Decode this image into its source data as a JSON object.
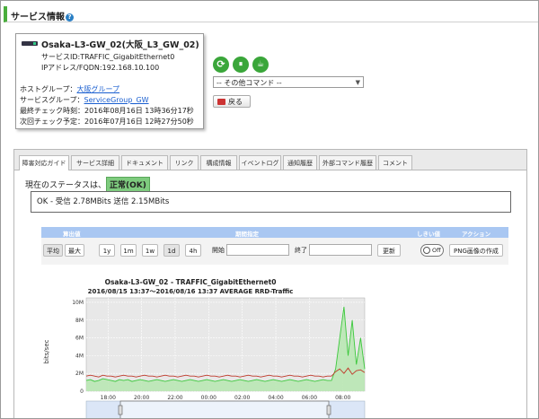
{
  "header": {
    "title": "サービス情報"
  },
  "info": {
    "name": "Osaka-L3-GW_02(大阪_L3_GW_02)",
    "service_id": "サービスID:TRAFFIC_GigabitEthernet0",
    "ip": "IPアドレス/FQDN:192.168.10.100",
    "host_group_label": "ホストグループ：",
    "host_group": "大阪グループ",
    "service_group_label": "サービスグループ：",
    "service_group": "ServiceGroup_GW",
    "last_check": "最終チェック時刻：2016年08月16日 13時36分17秒",
    "next_check": "次回チェック予定：2016年07月16日 12時27分50秒"
  },
  "actions": {
    "select_value": "-- その他コマンド --",
    "back_label": "戻る",
    "icons": [
      "refresh-icon",
      "pause-icon",
      "coffee-icon"
    ]
  },
  "tabs": [
    "障害対応ガイド",
    "サービス詳細",
    "ドキュメント",
    "リンク",
    "構成情報",
    "イベントログ",
    "通知履歴",
    "外部コマンド履歴",
    "コメント"
  ],
  "status": {
    "label": "現在のステータスは、",
    "badge": "正常(OK)",
    "badge_color": "#7ecb7e",
    "message": "OK - 受信 2.78MBits 送信 2.15MBits"
  },
  "controls": {
    "headers": {
      "calc": "算出値",
      "period": "期間指定",
      "threshold": "しきい値",
      "action": "アクション"
    },
    "avg": "平均",
    "max": "最大",
    "ranges": [
      "1y",
      "1m",
      "1w",
      "1d",
      "4h"
    ],
    "start_label": "開始",
    "end_label": "終了",
    "update": "更新",
    "toggle": "Off",
    "png": "PNG画像の作成"
  },
  "chart_data": {
    "type": "area",
    "title": "Osaka-L3-GW_02 - TRAFFIC_GigabitEthernet0",
    "subtitle": "2016/08/15 13:37～2016/08/16 13:37 AVERAGE RRD-Traffic",
    "ylabel": "bits/sec",
    "yticks": [
      "0",
      "2M",
      "4M",
      "6M",
      "8M",
      "10M"
    ],
    "ylim": [
      0,
      10.5
    ],
    "xticks": [
      "18:00",
      "20:00",
      "22:00",
      "00:00",
      "02:00",
      "04:00",
      "06:00",
      "08:00"
    ],
    "series": [
      {
        "color": "#3cc83c",
        "values": [
          1.2,
          1.3,
          1.1,
          1.2,
          1.4,
          1.3,
          1.2,
          1.1,
          1.3,
          1.2,
          1.3,
          1.1,
          1.2,
          1.3,
          1.2,
          1.1,
          1.2,
          1.3,
          1.2,
          1.1,
          1.2,
          1.3,
          1.2,
          1.1,
          1.2,
          1.3,
          1.2,
          1.1,
          1.2,
          1.3,
          1.2,
          1.1,
          1.2,
          1.3,
          1.2,
          1.1,
          1.2,
          1.3,
          1.2,
          1.1,
          1.2,
          1.3,
          1.2,
          1.1,
          1.2,
          1.3,
          1.2,
          1.1,
          1.2,
          1.3,
          1.2,
          1.1,
          1.2,
          1.3,
          1.2,
          1.1,
          1.2,
          1.3,
          1.2,
          1.2,
          2.5,
          6,
          9.5,
          4,
          8,
          3,
          6,
          2.5
        ]
      },
      {
        "color": "#c0392b",
        "values": [
          1.7,
          1.8,
          1.7,
          1.6,
          1.8,
          1.7,
          1.7,
          1.6,
          1.7,
          1.8,
          1.7,
          1.7,
          1.6,
          1.7,
          1.8,
          1.7,
          1.7,
          1.6,
          1.7,
          1.8,
          1.7,
          1.7,
          1.6,
          1.7,
          1.8,
          1.7,
          1.7,
          1.6,
          1.7,
          1.8,
          1.7,
          1.7,
          1.6,
          1.7,
          1.8,
          1.7,
          1.7,
          1.6,
          1.7,
          1.8,
          1.7,
          1.7,
          1.6,
          1.7,
          1.8,
          1.7,
          1.7,
          1.6,
          1.7,
          1.8,
          1.7,
          1.7,
          1.6,
          1.7,
          1.8,
          1.7,
          1.7,
          1.6,
          1.7,
          1.7,
          2.2,
          2.5,
          2,
          2.6,
          1.9,
          2.3,
          2.4,
          2.1
        ]
      }
    ]
  }
}
